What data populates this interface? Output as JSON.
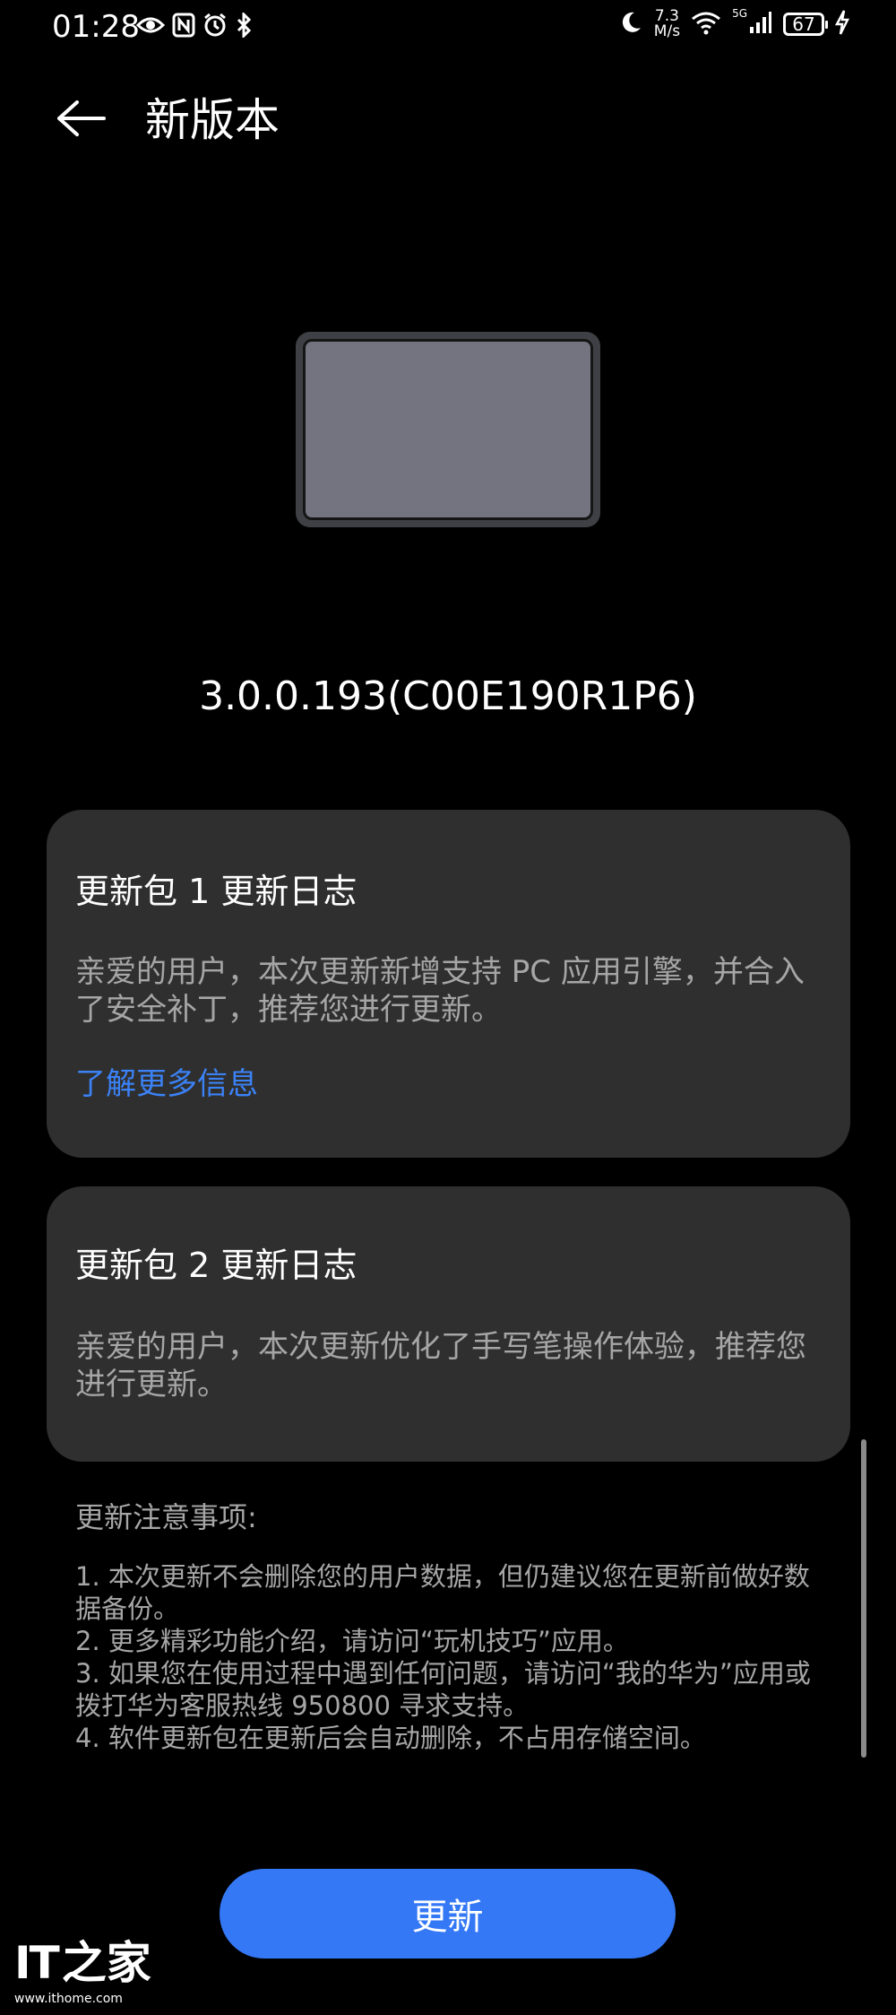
{
  "status_bar": {
    "time": "01:28",
    "net_speed_value": "7.3",
    "net_speed_unit": "M/s",
    "signal_label": "5G",
    "battery_level": "67"
  },
  "header": {
    "title": "新版本"
  },
  "version": "3.0.0.193(C00E190R1P6)",
  "cards": [
    {
      "title": "更新包 1 更新日志",
      "body": "亲爱的用户，本次更新新增支持 PC 应用引擎，并合入了安全补丁，推荐您进行更新。",
      "link": "了解更多信息"
    },
    {
      "title": "更新包 2 更新日志",
      "body": "亲爱的用户，本次更新优化了手写笔操作体验，推荐您进行更新。"
    }
  ],
  "notes": {
    "title": "更新注意事项:",
    "items": [
      "1. 本次更新不会删除您的用户数据，但仍建议您在更新前做好数据备份。",
      "2. 更多精彩功能介绍，请访问“玩机技巧”应用。",
      "3. 如果您在使用过程中遇到任何问题，请访问“我的华为”应用或拨打华为客服热线 950800 寻求支持。",
      "4. 软件更新包在更新后会自动删除，不占用存储空间。"
    ]
  },
  "update_button_label": "更新",
  "watermark": {
    "logo_latin": "IT",
    "logo_chinese": "之家",
    "url": "www.ithome.com"
  },
  "colors": {
    "background": "#000000",
    "card": "#2f2f2f",
    "accent": "#3478f6",
    "link": "#3b82f6",
    "secondary_text": "#a6a6a6"
  }
}
